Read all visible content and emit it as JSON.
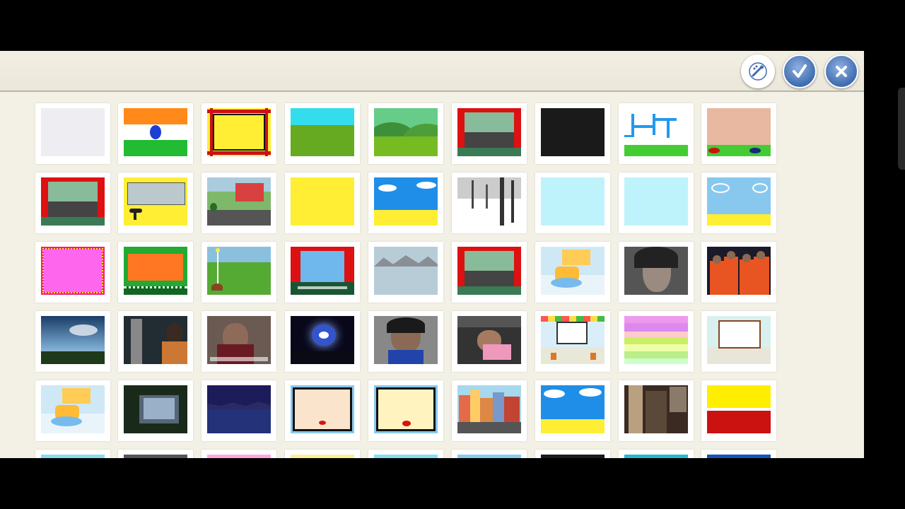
{
  "toolbar": {
    "buttons": [
      {
        "name": "paint-new-backdrop-button",
        "icon": "paintbrush-icon"
      },
      {
        "name": "confirm-button",
        "icon": "checkmark-icon"
      },
      {
        "name": "close-button",
        "icon": "close-icon"
      }
    ]
  },
  "colors": {
    "toolbar_bg": "#f2efe3",
    "panel_bg": "#f3f0e5",
    "button_blue": "#3f6cb0",
    "letterbox": "#000000"
  },
  "backdrops": {
    "rows": [
      [
        "blank-white",
        "india-flag",
        "yellow-frame",
        "grass-sky",
        "green-hills",
        "theater-stage",
        "black",
        "blue-maze",
        "beige-field"
      ],
      [
        "theater-stage",
        "yellow-screen",
        "red-house-street",
        "yellow",
        "beach-clouds",
        "winter-trees",
        "light-blue",
        "light-blue",
        "sky-sand"
      ],
      [
        "pink-lights-stage",
        "orange-tent",
        "golf-flag",
        "blue-curtain-stage",
        "grey-mountains",
        "theater-stage",
        "classroom",
        "portrait-photo",
        "astronaut-crew-photo"
      ],
      [
        "sky-landscape-photo",
        "launch-photo",
        "interview-photo",
        "space-photo",
        "headset-photo",
        "cockpit-photo",
        "classroom-whiteboard",
        "stripes",
        "whiteboard"
      ],
      [
        "classroom",
        "dark-screen-photo",
        "night-sea",
        "framed-screen",
        "framed-screen-yellow",
        "city-street",
        "clouds-sand",
        "doorway-photo",
        "yellow-red"
      ],
      [
        "partial",
        "partial",
        "partial",
        "partial",
        "partial",
        "partial",
        "partial",
        "partial",
        "partial"
      ]
    ]
  }
}
